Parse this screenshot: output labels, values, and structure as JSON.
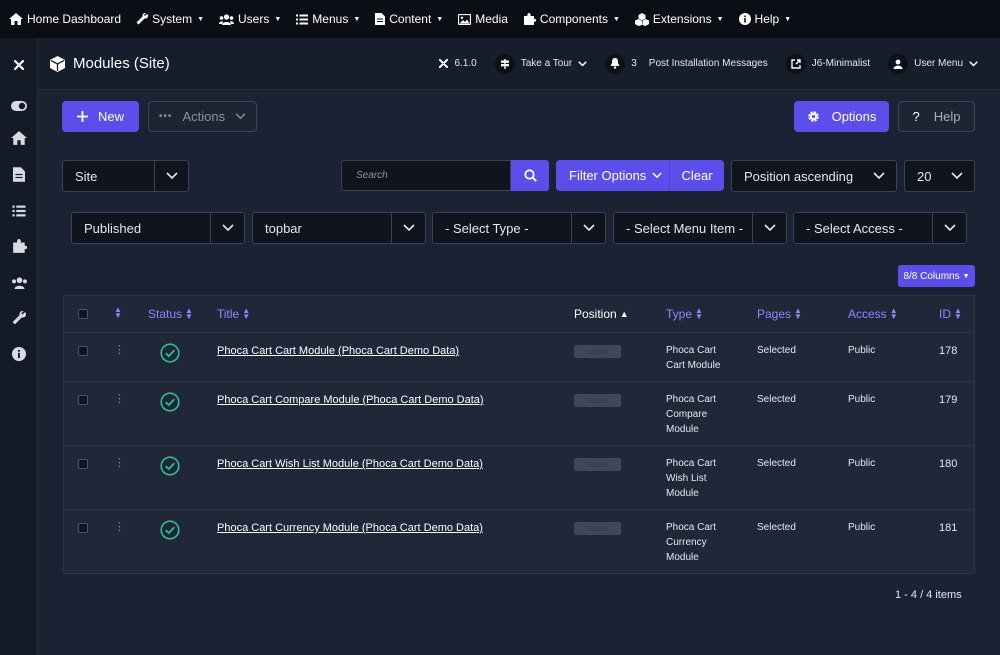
{
  "topbar": {
    "items": [
      {
        "label": "Home Dashboard",
        "icon": "home-icon"
      },
      {
        "label": "System",
        "icon": "wrench-icon"
      },
      {
        "label": "Users",
        "icon": "users-icon"
      },
      {
        "label": "Menus",
        "icon": "list-icon"
      },
      {
        "label": "Content",
        "icon": "file-icon"
      },
      {
        "label": "Media",
        "icon": "image-icon"
      },
      {
        "label": "Components",
        "icon": "puzzle-icon"
      },
      {
        "label": "Extensions",
        "icon": "cubes-icon"
      },
      {
        "label": "Help",
        "icon": "info-icon"
      }
    ]
  },
  "header": {
    "title": "Modules (Site)",
    "version": "6.1.0",
    "tour": "Take a Tour",
    "messages_count": "3",
    "messages": "Post Installation Messages",
    "template": "J6-Minimalist",
    "user_menu": "User Menu"
  },
  "toolbar": {
    "new_label": "New",
    "actions_label": "Actions",
    "options_label": "Options",
    "help_label": "Help"
  },
  "filters": {
    "client": "Site",
    "search_placeholder": "Search",
    "filter_options": "Filter Options",
    "clear": "Clear",
    "ordering": "Position ascending",
    "limit": "20",
    "state": "Published",
    "position": "topbar",
    "type": "- Select Type -",
    "menu_item": "- Select Menu Item -",
    "access": "- Select Access -"
  },
  "columns_button": "8/8 Columns",
  "table": {
    "headers": {
      "status": "Status",
      "title": "Title",
      "position": "Position",
      "type": "Type",
      "pages": "Pages",
      "access": "Access",
      "id": "ID"
    },
    "rows": [
      {
        "title": "Phoca Cart Cart Module (Phoca Cart Demo Data)",
        "position": "topbar",
        "type": [
          "Phoca Cart",
          "Cart Module"
        ],
        "pages": "Selected",
        "access": "Public",
        "id": "178"
      },
      {
        "title": "Phoca Cart Compare Module (Phoca Cart Demo Data)",
        "position": "topbar",
        "type": [
          "Phoca Cart",
          "Compare",
          "Module"
        ],
        "pages": "Selected",
        "access": "Public",
        "id": "179"
      },
      {
        "title": "Phoca Cart Wish List Module (Phoca Cart Demo Data)",
        "position": "topbar",
        "type": [
          "Phoca Cart",
          "Wish List",
          "Module"
        ],
        "pages": "Selected",
        "access": "Public",
        "id": "180"
      },
      {
        "title": "Phoca Cart Currency Module (Phoca Cart Demo Data)",
        "position": "topbar",
        "type": [
          "Phoca Cart",
          "Currency",
          "Module"
        ],
        "pages": "Selected",
        "access": "Public",
        "id": "181"
      }
    ]
  },
  "pagination": "1 - 4 / 4 items",
  "colors": {
    "accent": "#5b4eea",
    "status_published": "#2fbf8a",
    "background": "#1a2233"
  }
}
